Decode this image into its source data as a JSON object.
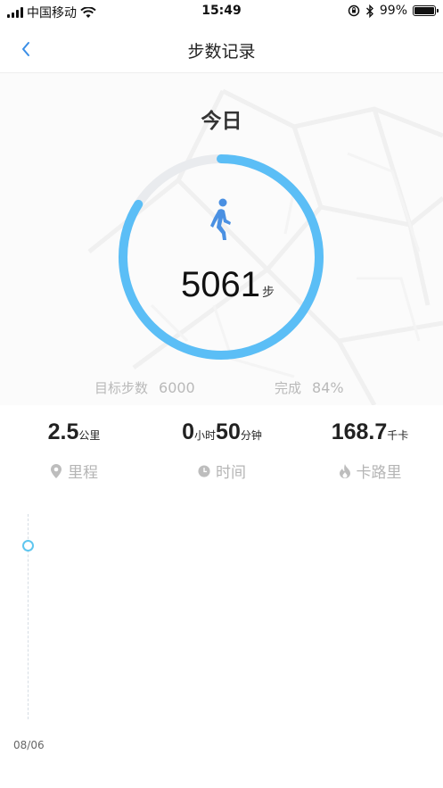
{
  "status_bar": {
    "carrier": "中国移动",
    "time": "15:49",
    "battery": "99%",
    "battery_level": 0.99
  },
  "nav": {
    "title": "步数记录",
    "back_icon": "chevron-left-icon"
  },
  "hero": {
    "day_label": "今日",
    "steps": "5061",
    "steps_unit": "步",
    "progress": 0.84,
    "goal_label": "目标步数",
    "goal_value": "6000",
    "complete_label": "完成",
    "complete_value": "84%",
    "ring_color": "#5bbef6",
    "ring_track_color": "#e9ebee",
    "walk_icon_color": "#4a90e2"
  },
  "stats": [
    {
      "value": "2.5",
      "unit": "公里",
      "label": "里程",
      "icon": "location-pin-icon"
    },
    {
      "hours": "0",
      "hours_unit": "小时",
      "minutes": "50",
      "minutes_unit": "分钟",
      "label": "时间",
      "icon": "clock-icon"
    },
    {
      "value": "168.7",
      "unit": "千卡",
      "label": "卡路里",
      "icon": "flame-icon"
    }
  ],
  "timeline": {
    "date": "08/06",
    "dot_color": "#5fc6ef"
  }
}
